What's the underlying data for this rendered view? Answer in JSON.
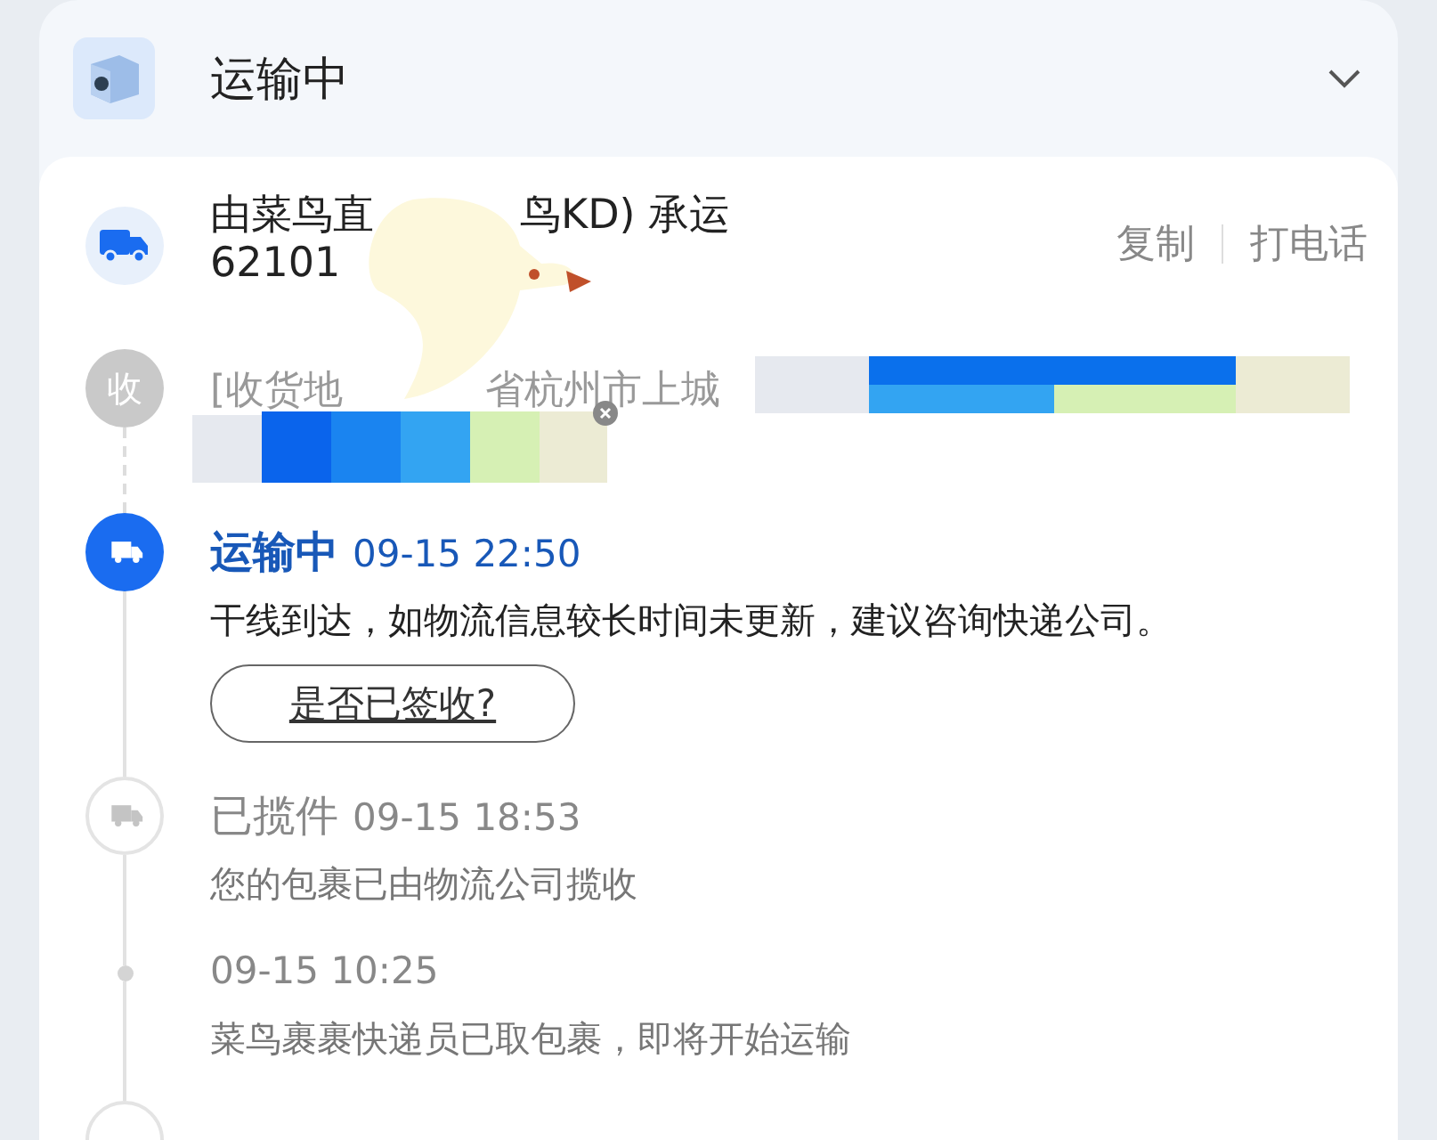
{
  "header": {
    "title": "运输中"
  },
  "carrier": {
    "line_parts": [
      "由菜鸟直",
      "鸟KD) 承运"
    ],
    "tracking_number": "62101",
    "actions": [
      "复制",
      "打电话"
    ]
  },
  "address": {
    "badge": "收",
    "parts": [
      "[收货地",
      "省杭州市上城"
    ]
  },
  "events": [
    {
      "kind": "current",
      "status": "运输中",
      "time": "09-15 22:50",
      "detail": "干线到达，如物流信息较长时间未更新，建议咨询快递公司。",
      "button": "是否已签收?"
    },
    {
      "kind": "past",
      "status": "已揽件",
      "time": "09-15 18:53",
      "detail": "您的包裹已由物流公司揽收"
    },
    {
      "kind": "minor",
      "time": "09-15 10:25",
      "detail": "菜鸟裹裹快递员已取包裹，即将开始运输"
    }
  ]
}
